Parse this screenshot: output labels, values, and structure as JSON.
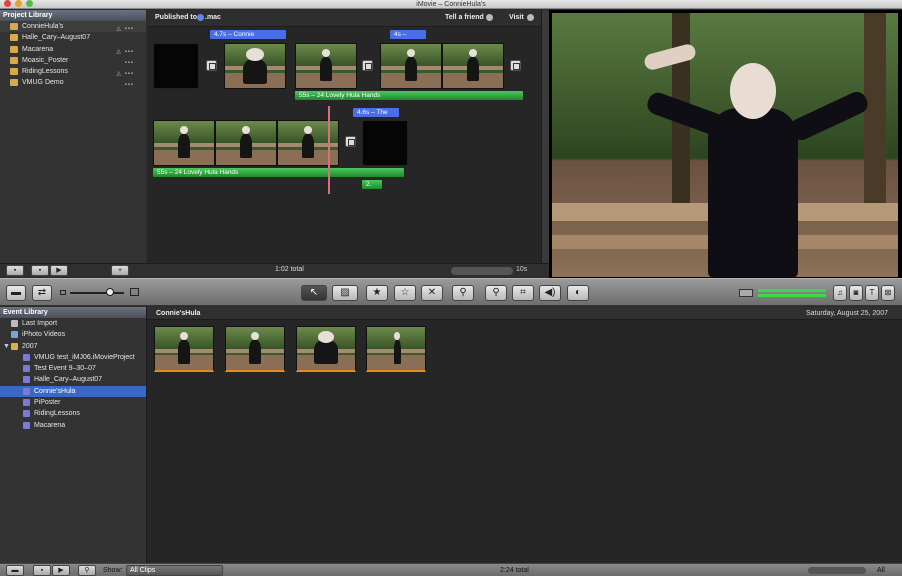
{
  "window": {
    "title": "iMovie – ConnieHula's"
  },
  "project_library": {
    "header": "Project Library",
    "items": [
      {
        "name": "ConnieHula's"
      },
      {
        "name": "Halle_Cary–August07"
      },
      {
        "name": "Macarena"
      },
      {
        "name": "Moasic_Poster"
      },
      {
        "name": "RidingLessons"
      },
      {
        "name": "VMUG Demo"
      }
    ]
  },
  "project_header": {
    "published_to": "Published to",
    "published_dest": ".mac",
    "tell_friend": "Tell a friend",
    "visit": "Visit"
  },
  "project": {
    "tags": [
      "4.7s – Connie",
      "4s –",
      "4.6s – The"
    ],
    "music1": "55s – 24 Lovely Hula Hands",
    "music2": "55s – 24 Lovely Hula Hands",
    "marker": "2.",
    "total": "1:02 total",
    "zoom": "10s"
  },
  "event_library": {
    "header": "Event Library",
    "items": [
      {
        "name": "Last Import"
      },
      {
        "name": "iPhoto Videos"
      },
      {
        "name": "2007"
      },
      {
        "name": "VMUG test_iMJ06.iMovieProject"
      },
      {
        "name": "Test Event 9–30–07"
      },
      {
        "name": "Halle_Cary–August07"
      },
      {
        "name": "Connie'sHula"
      },
      {
        "name": "PiPoster"
      },
      {
        "name": "RidingLessons"
      },
      {
        "name": "Macarena"
      }
    ]
  },
  "event": {
    "title": "Connie'sHula",
    "date": "Saturday, August 25, 2007"
  },
  "status_bar": {
    "show_label": "Show:",
    "show_value": "All Clips",
    "total": "2:24 total",
    "all": "All"
  },
  "colors": {
    "accent": "#3b67c7",
    "green": "#2fae3e",
    "tag_blue": "#4a6ee8"
  }
}
